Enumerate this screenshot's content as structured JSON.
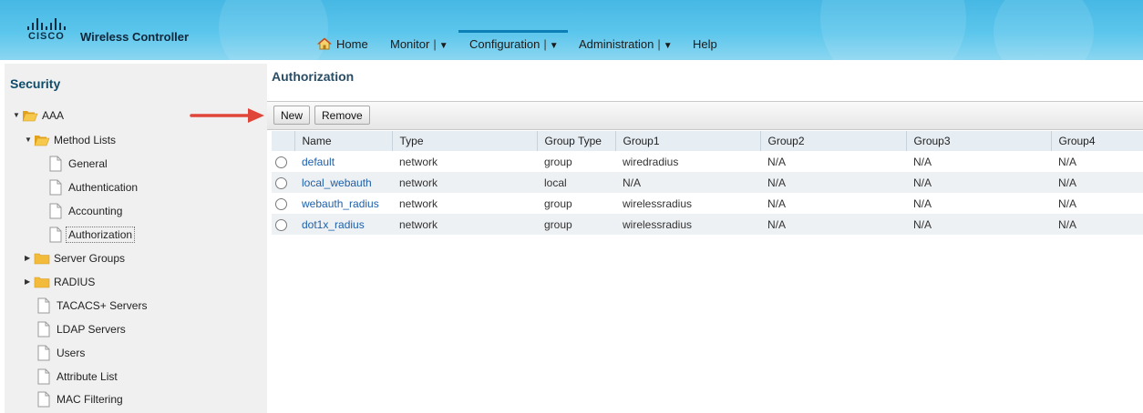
{
  "header": {
    "logo_text": "CISCO",
    "product_name": "Wireless Controller",
    "nav": [
      {
        "label": "Home"
      },
      {
        "label": "Monitor"
      },
      {
        "label": "Configuration"
      },
      {
        "label": "Administration"
      },
      {
        "label": "Help"
      }
    ],
    "active_nav": "Configuration",
    "accent_color": "#4db9e6"
  },
  "sidebar": {
    "title": "Security",
    "items": [
      {
        "label": "AAA",
        "type": "folder",
        "expanded": true
      },
      {
        "label": "Method Lists",
        "type": "folder",
        "expanded": true
      },
      {
        "label": "General",
        "type": "page"
      },
      {
        "label": "Authentication",
        "type": "page"
      },
      {
        "label": "Accounting",
        "type": "page"
      },
      {
        "label": "Authorization",
        "type": "page",
        "selected": true
      },
      {
        "label": "Server Groups",
        "type": "folder",
        "expanded": false
      },
      {
        "label": "RADIUS",
        "type": "folder",
        "expanded": false
      },
      {
        "label": "TACACS+ Servers",
        "type": "page"
      },
      {
        "label": "LDAP Servers",
        "type": "page"
      },
      {
        "label": "Users",
        "type": "page"
      },
      {
        "label": "Attribute List",
        "type": "page"
      },
      {
        "label": "MAC Filtering",
        "type": "page"
      }
    ]
  },
  "main": {
    "title": "Authorization",
    "toolbar": {
      "new_label": "New",
      "remove_label": "Remove"
    },
    "table": {
      "columns": [
        "Name",
        "Type",
        "Group Type",
        "Group1",
        "Group2",
        "Group3",
        "Group4"
      ],
      "rows": [
        [
          "default",
          "network",
          "group",
          "wiredradius",
          "N/A",
          "N/A",
          "N/A"
        ],
        [
          "local_webauth",
          "network",
          "local",
          "N/A",
          "N/A",
          "N/A",
          "N/A"
        ],
        [
          "webauth_radius",
          "network",
          "group",
          "wirelessradius",
          "N/A",
          "N/A",
          "N/A"
        ],
        [
          "dot1x_radius",
          "network",
          "group",
          "wirelessradius",
          "N/A",
          "N/A",
          "N/A"
        ]
      ]
    }
  },
  "annotation": {
    "arrow_color": "#e0453a",
    "points_to": "New"
  }
}
